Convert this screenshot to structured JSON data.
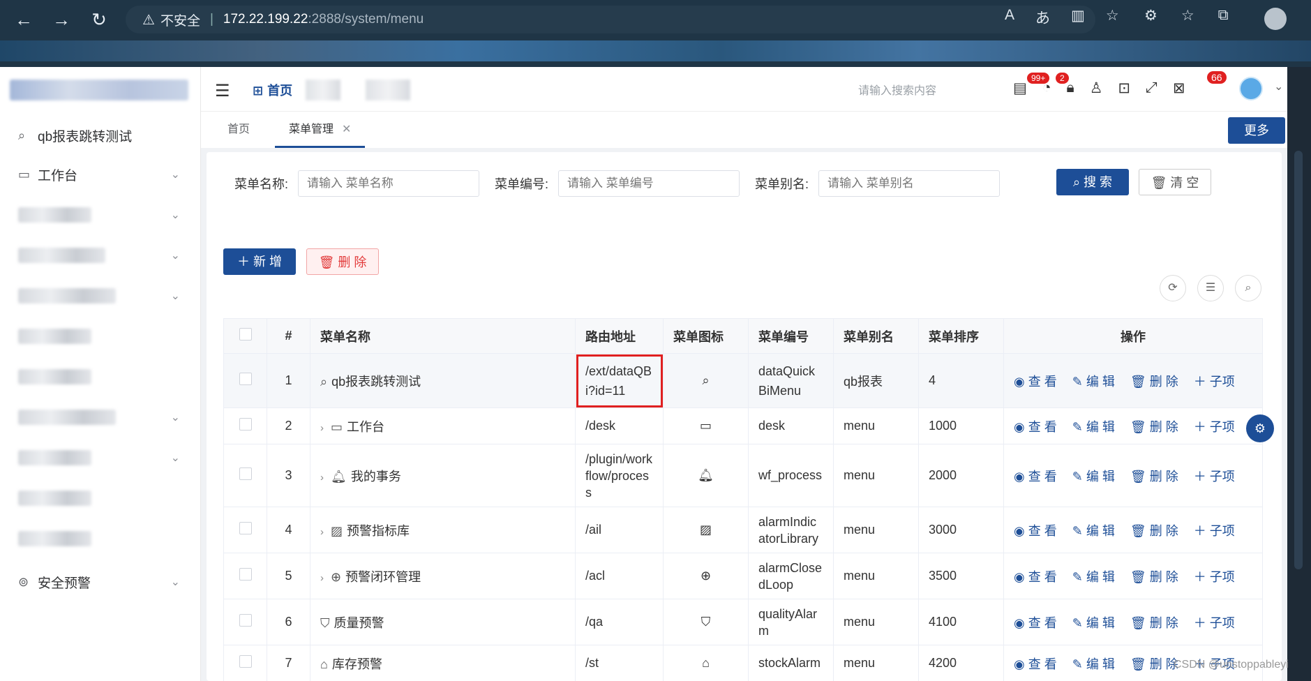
{
  "browser": {
    "security_label": "不安全",
    "url_host": "172.22.199.22",
    "url_path": ":2888/system/menu"
  },
  "header": {
    "home_label": "首页",
    "search_placeholder": "请输入搜索内容",
    "badges": [
      "99+",
      "2",
      "66"
    ]
  },
  "sidebar": {
    "items": [
      {
        "label": "qb报表跳转测试"
      },
      {
        "label": "工作台"
      },
      {
        "label": "安全预警"
      }
    ]
  },
  "tabs": [
    {
      "label": "首页"
    },
    {
      "label": "菜单管理"
    }
  ],
  "more_label": "更多",
  "filters": [
    {
      "label": "菜单名称:",
      "placeholder": "请输入 菜单名称"
    },
    {
      "label": "菜单编号:",
      "placeholder": "请输入 菜单编号"
    },
    {
      "label": "菜单别名:",
      "placeholder": "请输入 菜单别名"
    }
  ],
  "buttons": {
    "search": "搜 索",
    "clear": "清 空",
    "add": "新 增",
    "delete": "删 除"
  },
  "table": {
    "headers": [
      "#",
      "菜单名称",
      "路由地址",
      "菜单图标",
      "菜单编号",
      "菜单别名",
      "菜单排序",
      "操作"
    ],
    "ops": [
      "查 看",
      "编 辑",
      "删 除",
      "子项"
    ],
    "rows": [
      {
        "idx": "1",
        "name": "qb报表跳转测试",
        "route": "/ext/dataQBi?id=11",
        "code": "dataQuickBiMenu",
        "alias": "qb报表",
        "sort": "4"
      },
      {
        "idx": "2",
        "name": "工作台",
        "route": "/desk",
        "code": "desk",
        "alias": "menu",
        "sort": "1000"
      },
      {
        "idx": "3",
        "name": "我的事务",
        "route": "/plugin/workflow/process",
        "code": "wf_process",
        "alias": "menu",
        "sort": "2000"
      },
      {
        "idx": "4",
        "name": "预警指标库",
        "route": "/ail",
        "code": "alarmIndicatorLibrary",
        "alias": "menu",
        "sort": "3000"
      },
      {
        "idx": "5",
        "name": "预警闭环管理",
        "route": "/acl",
        "code": "alarmClosedLoop",
        "alias": "menu",
        "sort": "3500"
      },
      {
        "idx": "6",
        "name": "质量预警",
        "route": "/qa",
        "code": "qualityAlarm",
        "alias": "menu",
        "sort": "4100"
      },
      {
        "idx": "7",
        "name": "库存预警",
        "route": "/st",
        "code": "stockAlarm",
        "alias": "menu",
        "sort": "4200"
      }
    ]
  },
  "watermark": "CSDN @unstoppableyi"
}
